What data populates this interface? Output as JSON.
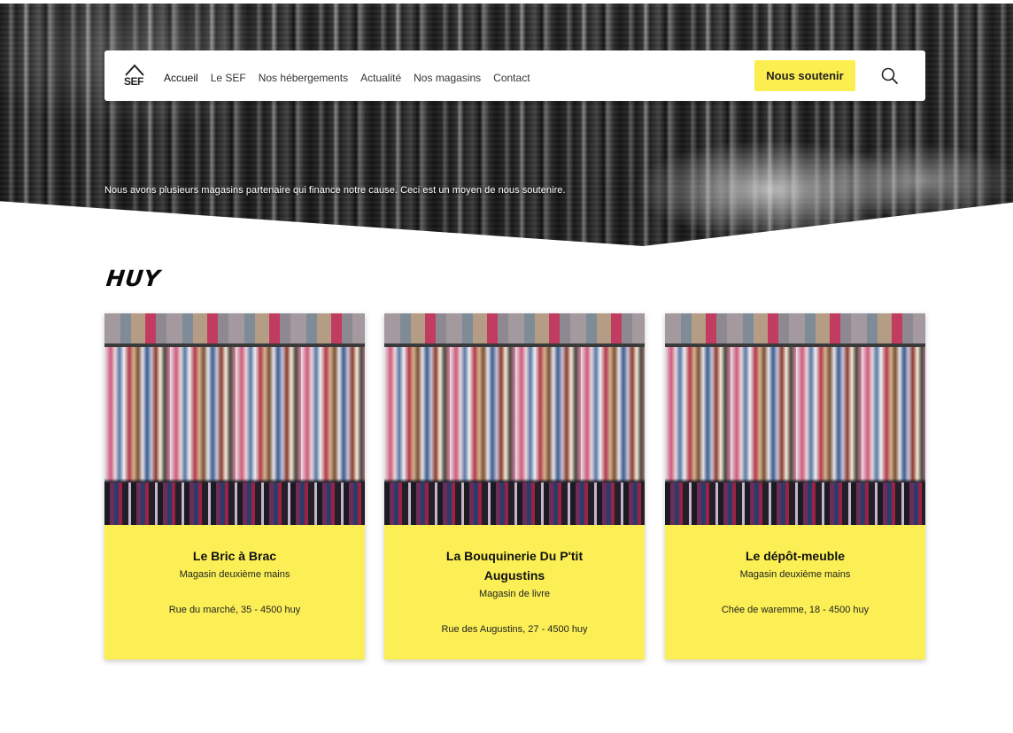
{
  "hero": {
    "text": "Nous avons plusieurs magasins partenaire qui finance notre cause. Ceci est un moyen de nous soutenire."
  },
  "nav": {
    "logo_text": "SEF",
    "links": [
      "Accueil",
      "Le SEF",
      "Nos hébergements",
      "Actualité",
      "Nos magasins",
      "Contact"
    ],
    "cta_label": "Nous soutenir"
  },
  "section": {
    "title": "HUY"
  },
  "stores": [
    {
      "name": "Le Bric à Brac",
      "type": "Magasin deuxième mains",
      "address": "Rue du marché, 35 - 4500 huy"
    },
    {
      "name": "La Bouquinerie Du  P'tit Augustins",
      "type": "Magasin de livre",
      "address": "Rue des Augustins, 27 - 4500 huy"
    },
    {
      "name": "Le dépôt-meuble",
      "type": "Magasin deuxième mains",
      "address": "Chée de waremme, 18 - 4500 huy"
    }
  ],
  "colors": {
    "accent": "#fdee4f",
    "card_bg": "#fbef55"
  },
  "icons": {
    "search": "search-icon",
    "logo": "house-logo-icon"
  }
}
